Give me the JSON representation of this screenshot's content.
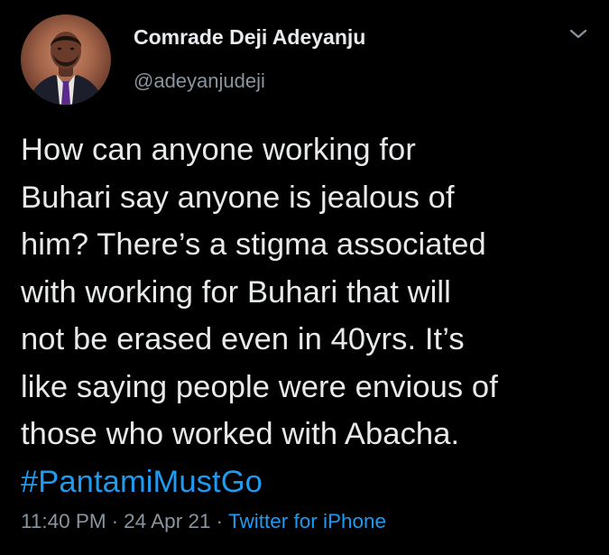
{
  "tweet": {
    "author": {
      "name": "Comrade Deji Adeyanju",
      "handle": "@adeyanjudeji"
    },
    "body_lines": [
      "How can anyone working for",
      "Buhari say anyone is jealous of",
      "him? There’s a stigma associated",
      "with working for Buhari that will",
      "not be erased even in 40yrs. It’s",
      "like saying people were envious of",
      "those who worked with Abacha."
    ],
    "hashtag": "#PantamiMustGo",
    "time": "11:40 PM",
    "date": "24 Apr 21",
    "separator": "·",
    "source": "Twitter for iPhone"
  },
  "colors": {
    "background": "#000000",
    "text": "#e7e9ea",
    "secondary": "#8a949e",
    "link": "#1d9bf0"
  },
  "icons": {
    "menu": "chevron-down-icon",
    "avatar": "profile-photo"
  }
}
